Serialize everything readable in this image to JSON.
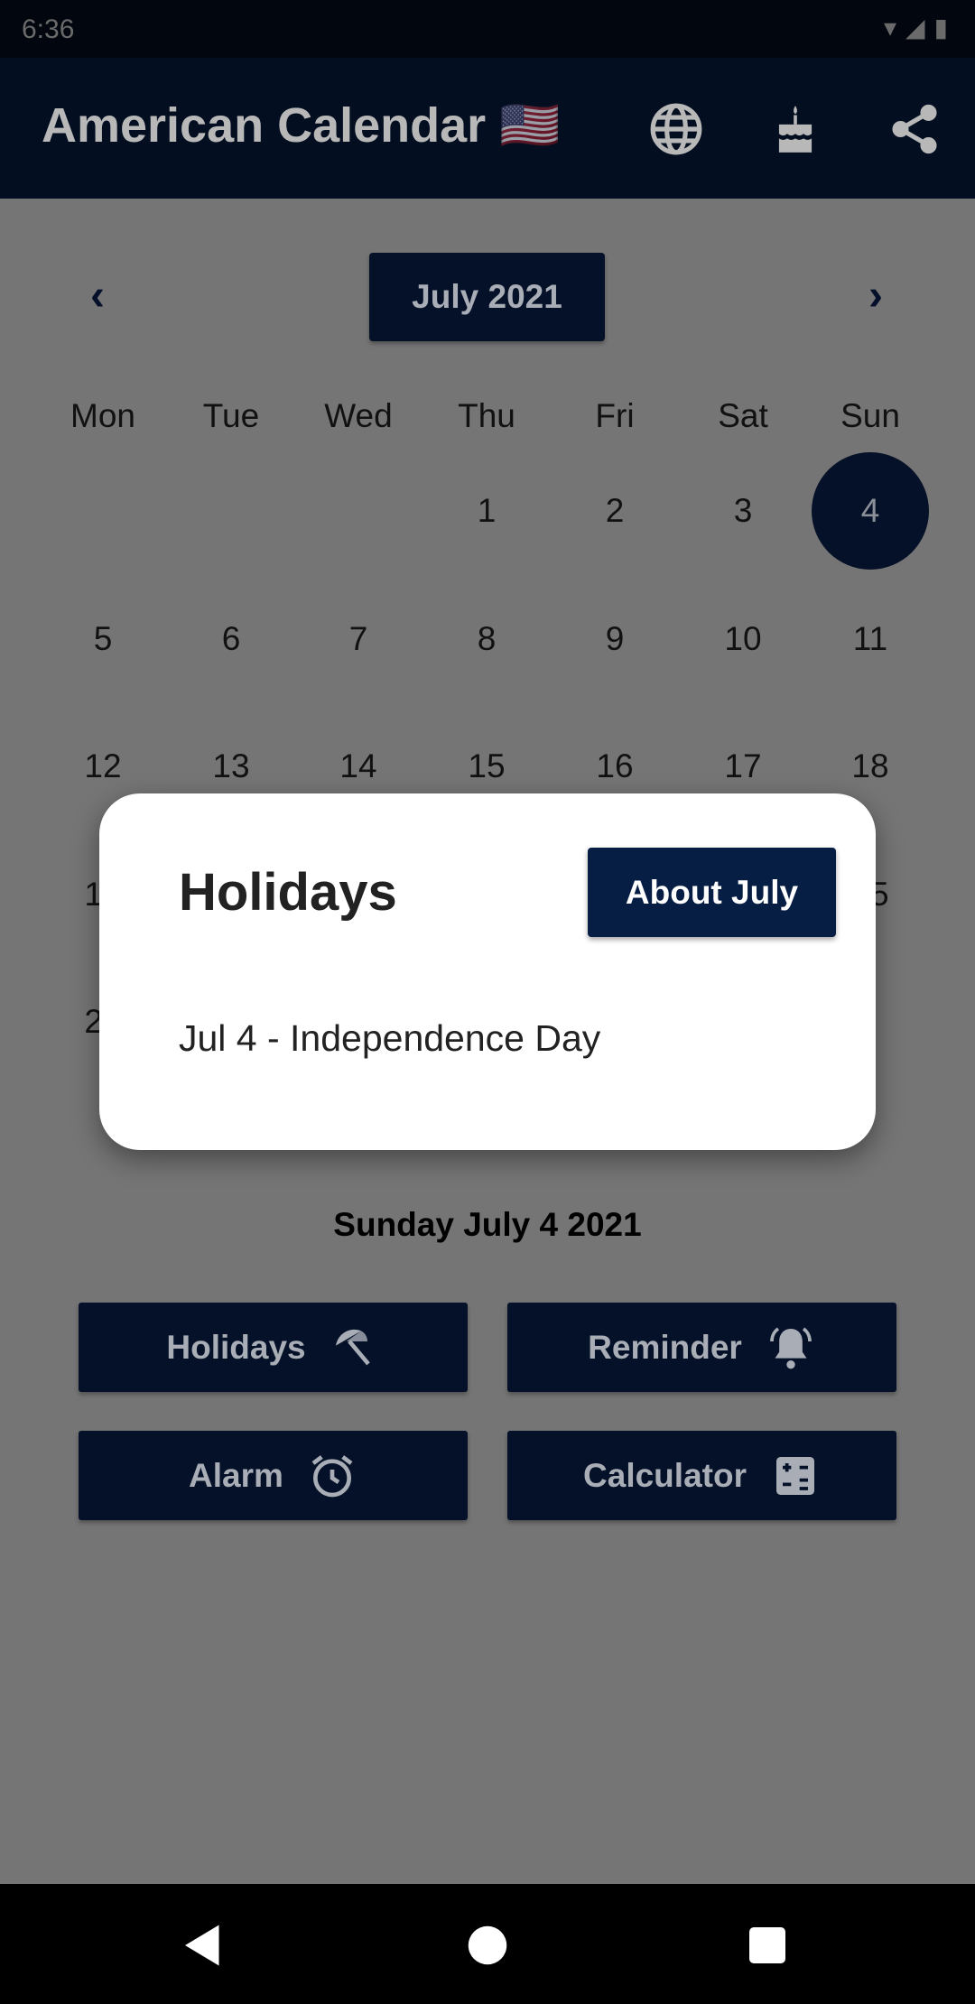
{
  "status_bar": {
    "time": "6:36"
  },
  "app_bar": {
    "title": "American Calendar",
    "flag": "🇺🇸",
    "icons": [
      "globe-icon",
      "birthday-cake-icon",
      "share-icon"
    ]
  },
  "calendar": {
    "month_label": "July 2021",
    "weekdays": [
      "Mon",
      "Tue",
      "Wed",
      "Thu",
      "Fri",
      "Sat",
      "Sun"
    ],
    "first_weekday_index": 3,
    "days_in_month": 31,
    "selected_day": 4
  },
  "selected_date": "Sunday July 4 2021",
  "actions": [
    {
      "label": "Holidays",
      "icon": "beach-umbrella-icon"
    },
    {
      "label": "Reminder",
      "icon": "bell-icon"
    },
    {
      "label": "Alarm",
      "icon": "alarm-clock-icon"
    },
    {
      "label": "Calculator",
      "icon": "calculator-icon"
    }
  ],
  "dialog": {
    "title": "Holidays",
    "about_button": "About July",
    "holidays": [
      "Jul 4 - Independence Day"
    ]
  },
  "colors": {
    "primary": "#0a2550",
    "scrim": "rgba(0,0,0,0.54)"
  }
}
